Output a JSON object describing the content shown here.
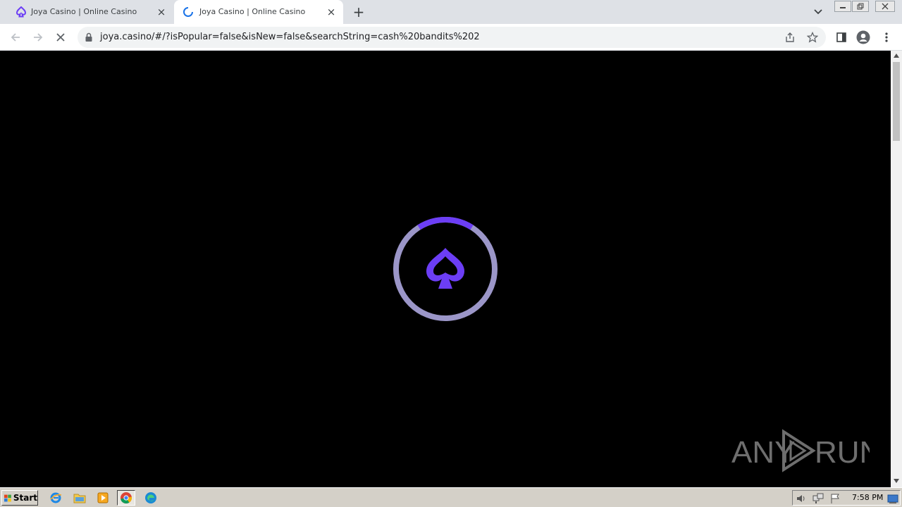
{
  "browser": {
    "tabs": [
      {
        "title": "Joya Casino | Online Casino",
        "active": false,
        "icon": "joya-spade-icon"
      },
      {
        "title": "Joya Casino | Online Casino",
        "active": true,
        "icon": "loading-spinner-icon"
      }
    ],
    "new_tab_label": "+",
    "close_symbol": "×",
    "address_bar": {
      "url": "joya.casino/#/?isPopular=false&isNew=false&searchString=cash%20bandits%202"
    }
  },
  "page": {
    "loader_icon": "spade-loader-icon",
    "loader_progress": 0.18,
    "watermark": "ANY RUN"
  },
  "taskbar": {
    "start_label": "Start",
    "apps": [
      "internet-explorer-icon",
      "folder-icon",
      "media-player-icon",
      "chrome-icon",
      "edge-icon"
    ],
    "clock": "7:58 PM"
  },
  "colors": {
    "accent": "#6c3ef5",
    "ring": "#9b96c8",
    "tabstrip": "#dee1e6"
  }
}
